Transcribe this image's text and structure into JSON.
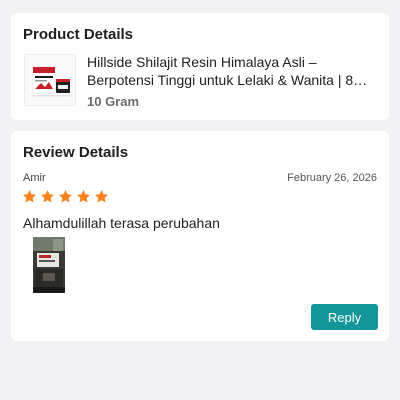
{
  "product_details": {
    "title": "Product Details",
    "product_name": "Hillside Shilajit Resin Himalaya Asli – Berpotensi Tinggi untuk Lelaki & Wanita | 8…",
    "variant": "10 Gram",
    "thumbnail_brand_text": "Shilajit"
  },
  "review_details": {
    "title": "Review Details",
    "reviewer": "Amir",
    "date": "February 26, 2026",
    "rating": 5,
    "rating_max": 5,
    "star_color": "#f5821f",
    "text": "Alhamdulillah terasa perubahan",
    "reply_label": "Reply",
    "reply_color": "#13969a"
  }
}
